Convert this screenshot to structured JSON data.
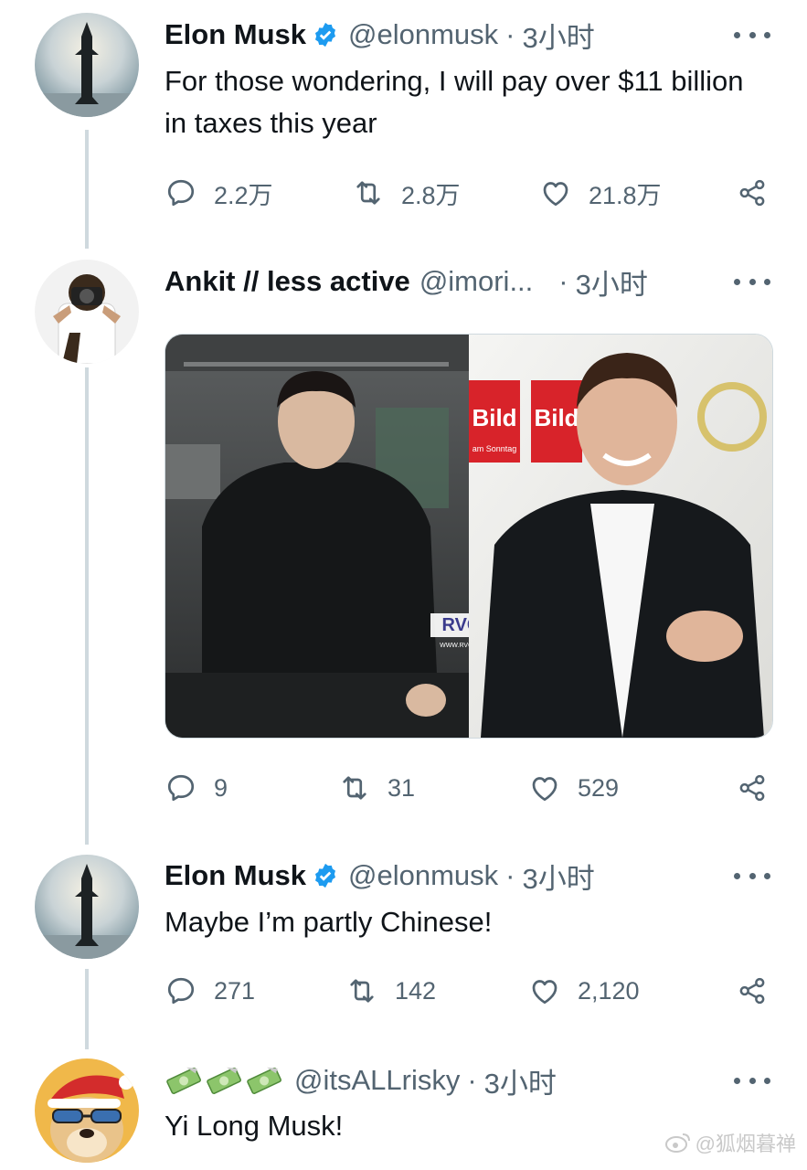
{
  "tweets": [
    {
      "name": "Elon Musk",
      "handle": "@elonmusk",
      "sep": "·",
      "time": "3小时",
      "text": "For those wondering, I will pay over $11 billion in taxes this year",
      "replies": "2.2万",
      "retweets": "2.8万",
      "likes": "21.8万"
    },
    {
      "name": "Ankit // less active",
      "handle": "@imori...",
      "sep": "·",
      "time": "3小时",
      "text": "",
      "media_badge": "RVCJ",
      "media_url": "WWW.RVCJ.COM",
      "sign_text": "Bild",
      "sign_sub": "am Sonntag",
      "replies": "9",
      "retweets": "31",
      "likes": "529"
    },
    {
      "name": "Elon Musk",
      "handle": "@elonmusk",
      "sep": "·",
      "time": "3小时",
      "text": "Maybe I’m partly Chinese!",
      "replies": "271",
      "retweets": "142",
      "likes": "2,120"
    },
    {
      "name_icons": [
        "money-icon",
        "money-icon",
        "money-icon"
      ],
      "handle": "@itsALLrisky",
      "sep": "·",
      "time": "3小时",
      "text": "Yi Long Musk!"
    }
  ],
  "watermark": "@狐烟暮禅",
  "colors": {
    "verified": "#1d9bf0",
    "secondary": "#536471",
    "thread": "#cfd9de"
  }
}
